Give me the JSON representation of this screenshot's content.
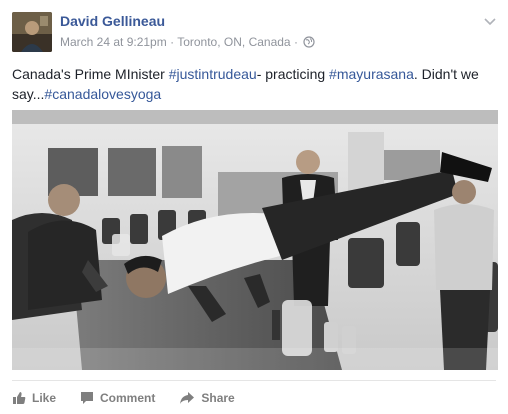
{
  "post": {
    "author": "David Gellineau",
    "date": "March 24 at 9:21pm",
    "separator": "·",
    "location": "Toronto, ON, Canada",
    "caption": {
      "part1": "Canada's Prime MInister ",
      "tag1": "#justintrudeau",
      "part2": "- practicing ",
      "tag2": "#mayurasana",
      "part3": ". Didn't we say...",
      "tag3": "#canadalovesyoga"
    },
    "actions": {
      "like": "Like",
      "comment": "Comment",
      "share": "Share"
    }
  },
  "colors": {
    "link": "#3b5998",
    "hashtag": "#365899",
    "meta": "#90949c",
    "action": "#7f7f7f"
  },
  "icons": [
    "globe-icon",
    "chevron-down-icon",
    "thumbs-up-icon",
    "comment-icon",
    "share-arrow-icon"
  ]
}
